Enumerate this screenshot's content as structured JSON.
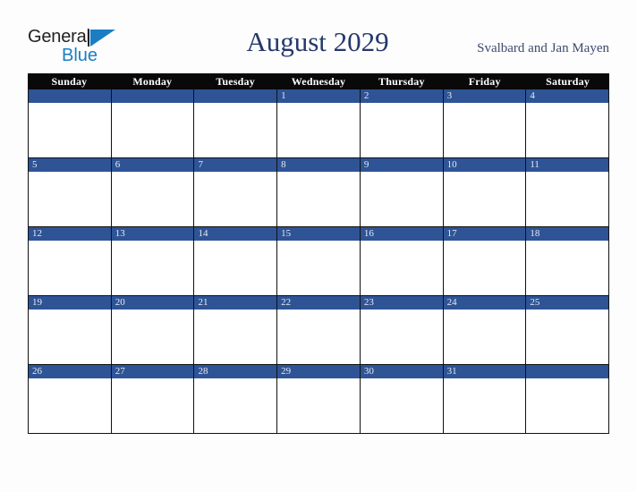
{
  "brand": {
    "line1": "General",
    "line2": "Blue",
    "triangle_icon": "blue-triangle-icon",
    "color_dark": "#231f20",
    "color_blue": "#1b7ec2"
  },
  "header": {
    "title": "August 2029",
    "region": "Svalbard and Jan Mayen"
  },
  "calendar": {
    "month": "August",
    "year": "2029",
    "accent_color": "#2e5496",
    "header_bg": "#090909",
    "day_names": [
      "Sunday",
      "Monday",
      "Tuesday",
      "Wednesday",
      "Thursday",
      "Friday",
      "Saturday"
    ],
    "weeks": [
      [
        "",
        "",
        "",
        "1",
        "2",
        "3",
        "4"
      ],
      [
        "5",
        "6",
        "7",
        "8",
        "9",
        "10",
        "11"
      ],
      [
        "12",
        "13",
        "14",
        "15",
        "16",
        "17",
        "18"
      ],
      [
        "19",
        "20",
        "21",
        "22",
        "23",
        "24",
        "25"
      ],
      [
        "26",
        "27",
        "28",
        "29",
        "30",
        "31",
        ""
      ]
    ]
  }
}
